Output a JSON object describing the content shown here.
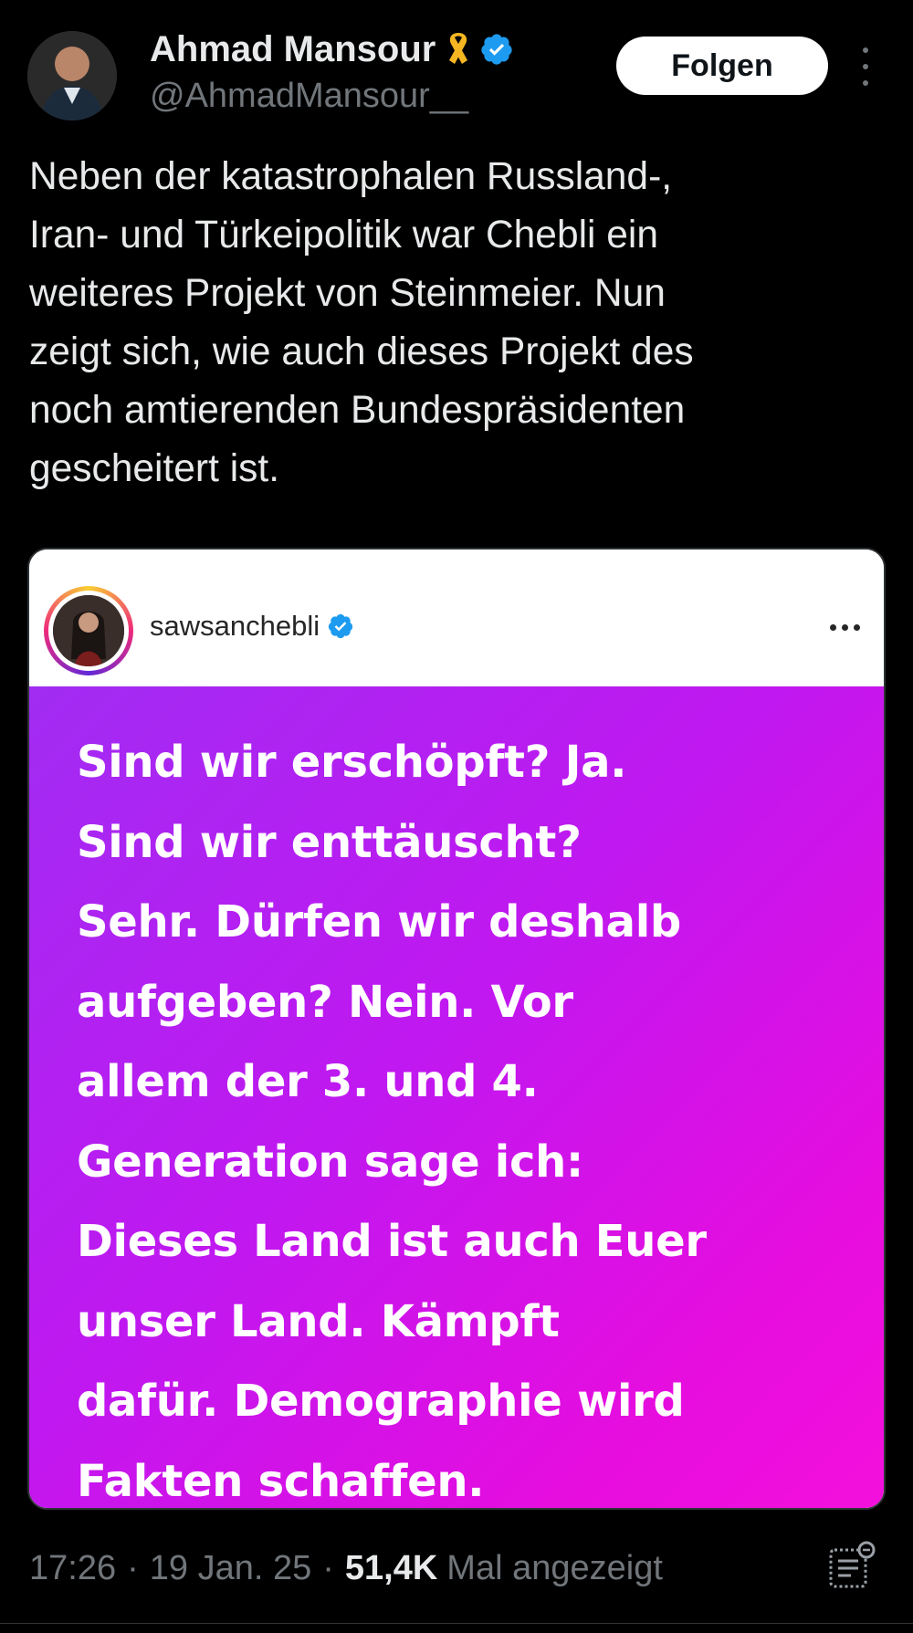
{
  "author": {
    "name": "Ahmad Mansour",
    "handle": "@AhmadMansour__",
    "follow_label": "Folgen"
  },
  "icons": {
    "ribbon": "yellow-ribbon-icon",
    "verified": "verified-badge-icon",
    "more": "more-vertical-icon",
    "analytics": "analytics-icon"
  },
  "tweet": {
    "text": "Neben der katastrophalen Russland-,\nIran- und Türkeipolitik war Chebli ein\nweiteres Projekt von Steinmeier. Nun\nzeigt sich, wie auch dieses Projekt des\nnoch amtierenden Bundespräsidenten\ngescheitert ist."
  },
  "embedded_post": {
    "username": "sawsanchebli",
    "quote": "Sind wir erschöpft? Ja.\nSind wir enttäuscht?\nSehr. Dürfen wir deshalb\naufgeben? Nein. Vor\nallem der 3. und 4.\nGeneration sage ich:\nDieses Land ist auch Euer\nunser Land. Kämpft\ndafür. Demographie wird\nFakten schaffen."
  },
  "meta": {
    "time": "17:26",
    "separator": "·",
    "date": "19 Jan. 25",
    "views_count": "51,4K",
    "views_label": "Mal angezeigt"
  },
  "colors": {
    "background": "#000000",
    "text_primary": "#e7e9ea",
    "text_secondary": "#71767b",
    "verified_blue": "#1d9bf0",
    "ribbon_yellow": "#f5b622",
    "post_gradient_start": "#a12cf2",
    "post_gradient_end": "#f410dc"
  }
}
